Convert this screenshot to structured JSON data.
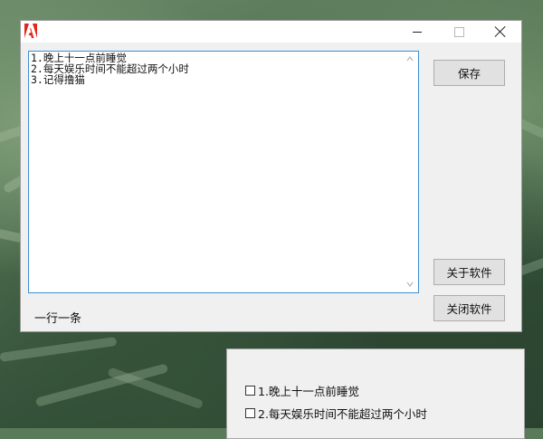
{
  "app": {
    "icon": "adobe-logo-icon"
  },
  "editor": {
    "lines": [
      "1.晚上十一点前睡觉",
      "2.每天娱乐时间不能超过两个小时",
      "3.记得撸猫"
    ]
  },
  "buttons": {
    "save": "保存",
    "about": "关于软件",
    "close_app": "关闭软件"
  },
  "hint": "一行一条",
  "checklist": {
    "items": [
      {
        "label": "1.晚上十一点前睡觉",
        "checked": false
      },
      {
        "label": "2.每天娱乐时间不能超过两个小时",
        "checked": false
      }
    ]
  },
  "colors": {
    "accent_border": "#3c8fd6",
    "adobe_red": "#e0281c"
  }
}
